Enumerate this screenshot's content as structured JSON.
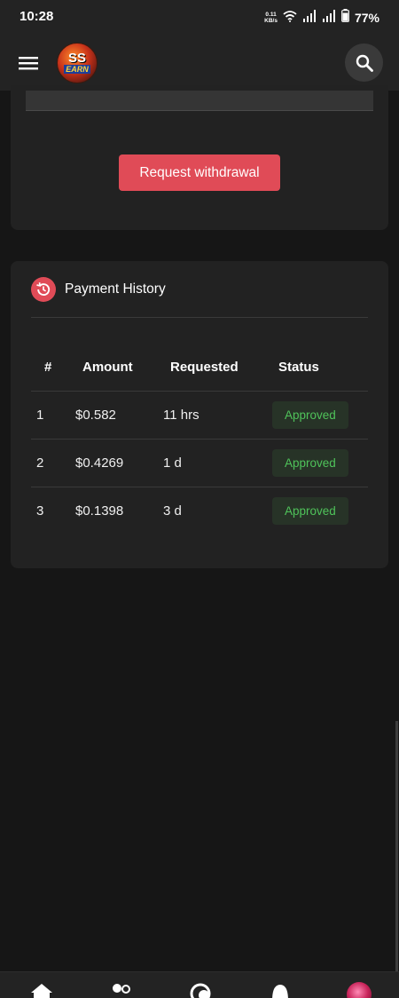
{
  "status_bar": {
    "time": "10:28",
    "net_speed_value": "0.11",
    "net_speed_unit": "KB/s",
    "battery": "77%"
  },
  "app_bar": {
    "logo_top": "SS",
    "logo_bottom": "EARN",
    "menu_icon": "hamburger-menu-icon",
    "search_icon": "search-icon"
  },
  "withdraw": {
    "button_label": "Request withdrawal",
    "accent": "#e04b57"
  },
  "history": {
    "title": "Payment History",
    "icon": "history-icon",
    "columns": [
      "#",
      "Amount",
      "Requested",
      "Status"
    ],
    "rows": [
      {
        "num": "1",
        "amount": "$0.582",
        "requested": "11 hrs",
        "status": "Approved"
      },
      {
        "num": "2",
        "amount": "$0.4269",
        "requested": "1 d",
        "status": "Approved"
      },
      {
        "num": "3",
        "amount": "$0.1398",
        "requested": "3 d",
        "status": "Approved"
      }
    ],
    "status_color": "#4fc35a"
  },
  "bottom_nav": {
    "items": [
      "home-icon",
      "users-icon",
      "chat-icon",
      "notification-icon",
      "profile-avatar"
    ]
  }
}
